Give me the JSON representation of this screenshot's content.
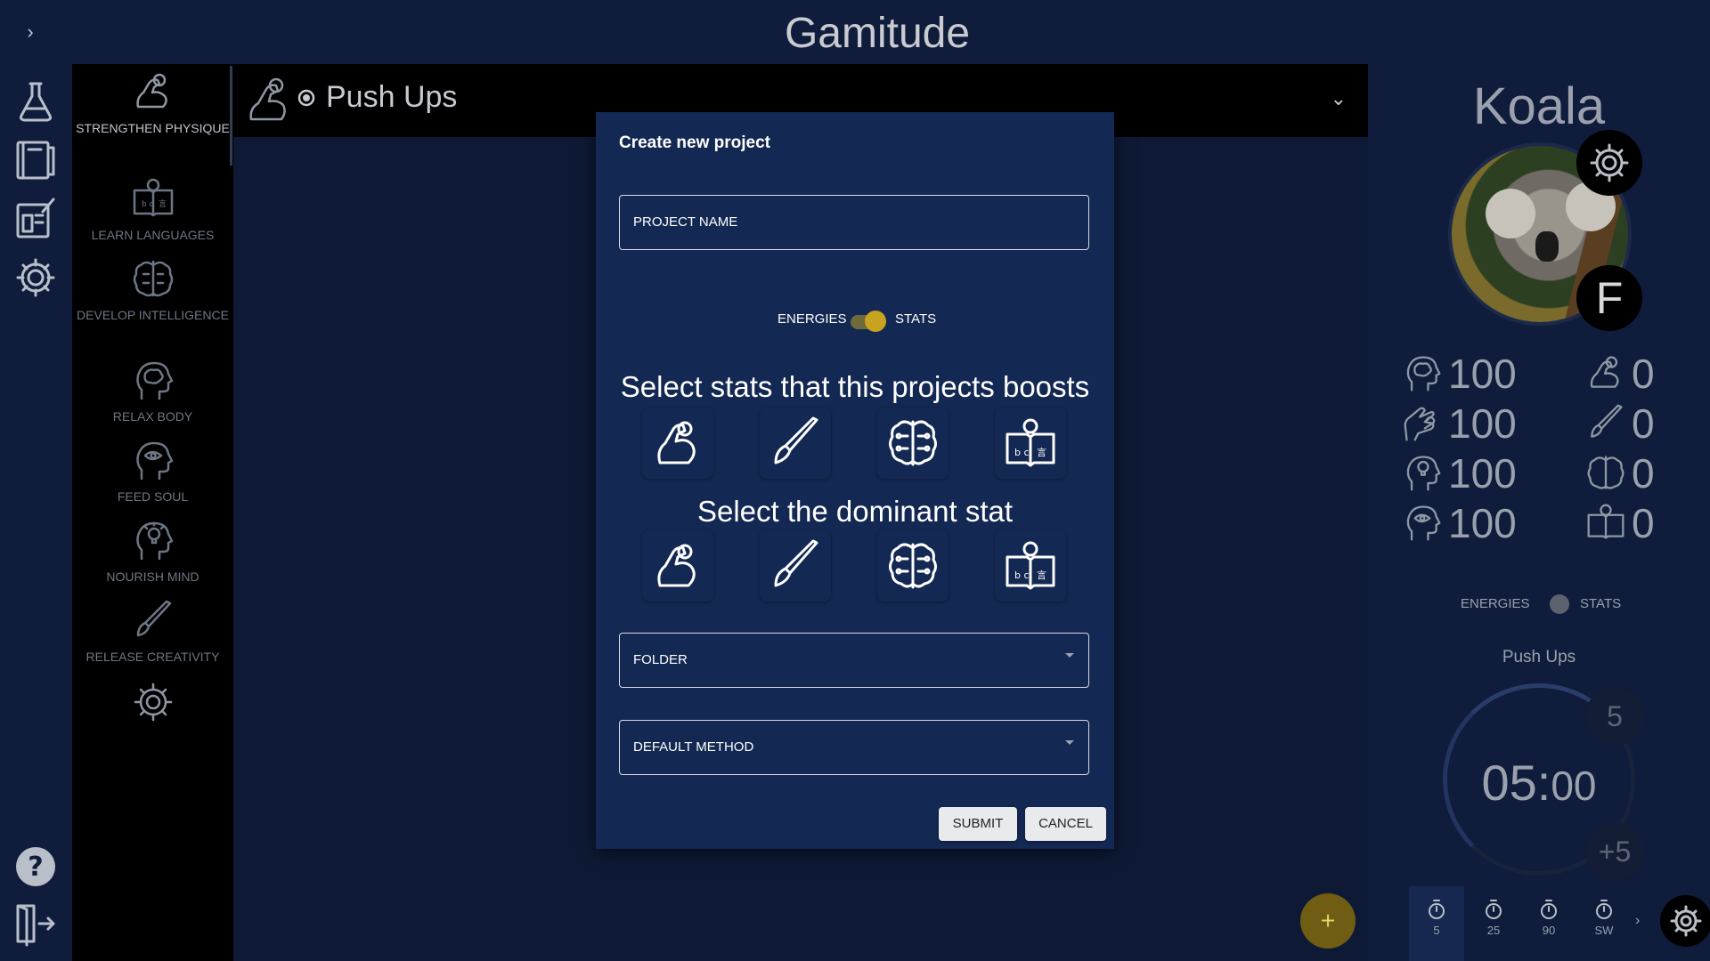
{
  "app": {
    "title": "Gamitude",
    "collapse_symbol": "›"
  },
  "iconbar": {
    "items": [
      {
        "icon": "flask-icon"
      },
      {
        "icon": "notebook-icon"
      },
      {
        "icon": "planner-icon"
      },
      {
        "icon": "gear-icon"
      }
    ],
    "bottom": [
      {
        "icon": "help-icon"
      },
      {
        "icon": "logout-icon"
      }
    ]
  },
  "categories": [
    {
      "label": "STRENGTHEN PHYSIQUE",
      "icon": "flexed-arm-icon",
      "active": true
    },
    {
      "label": "LEARN LANGUAGES",
      "icon": "language-book-icon"
    },
    {
      "label": "DEVELOP INTELLIGENCE",
      "icon": "circuit-brain-icon"
    },
    {
      "label": "RELAX BODY",
      "icon": "head-brain-icon"
    },
    {
      "label": "FEED SOUL",
      "icon": "head-eye-icon"
    },
    {
      "label": "NOURISH MIND",
      "icon": "head-bulb-icon"
    },
    {
      "label": "RELEASE CREATIVITY",
      "icon": "brush-icon"
    }
  ],
  "project_bar": {
    "title": "Push Ups",
    "icon": "flexed-arm-target-icon",
    "chevron": "⌄"
  },
  "profile": {
    "name": "Koala",
    "rank": "F",
    "energies": [
      {
        "icon": "head-brain-icon",
        "value": "100"
      },
      {
        "icon": "hand-heart-icon",
        "value": "100"
      },
      {
        "icon": "head-bulb-icon",
        "value": "100"
      },
      {
        "icon": "head-eye-icon",
        "value": "100"
      }
    ],
    "stats": [
      {
        "icon": "flexed-arm-icon",
        "value": "0"
      },
      {
        "icon": "brush-icon",
        "value": "0"
      },
      {
        "icon": "circuit-brain-icon",
        "value": "0"
      },
      {
        "icon": "language-book-icon",
        "value": "0"
      }
    ],
    "toggle": {
      "left": "ENERGIES",
      "right": "STATS"
    }
  },
  "timer": {
    "project": "Push Ups",
    "time_min": "05",
    "time_sep": ":",
    "time_sec": "00",
    "minus": "5",
    "plus": "+5",
    "presets": [
      "5",
      "25",
      "90",
      "SW"
    ],
    "active_preset": 0,
    "more": "›"
  },
  "fab": {
    "symbol": "+"
  },
  "modal": {
    "title": "Create new project",
    "project_name_placeholder": "PROJECT NAME",
    "toggle_left": "ENERGIES",
    "toggle_right": "STATS",
    "boost_heading": "Select stats that this projects boosts",
    "dominant_heading": "Select the dominant stat",
    "stat_icons": [
      "flexed-arm-icon",
      "brush-icon",
      "circuit-brain-icon",
      "language-book-icon"
    ],
    "folder_label": "FOLDER",
    "method_label": "DEFAULT METHOD",
    "submit_label": "SUBMIT",
    "cancel_label": "CANCEL"
  }
}
